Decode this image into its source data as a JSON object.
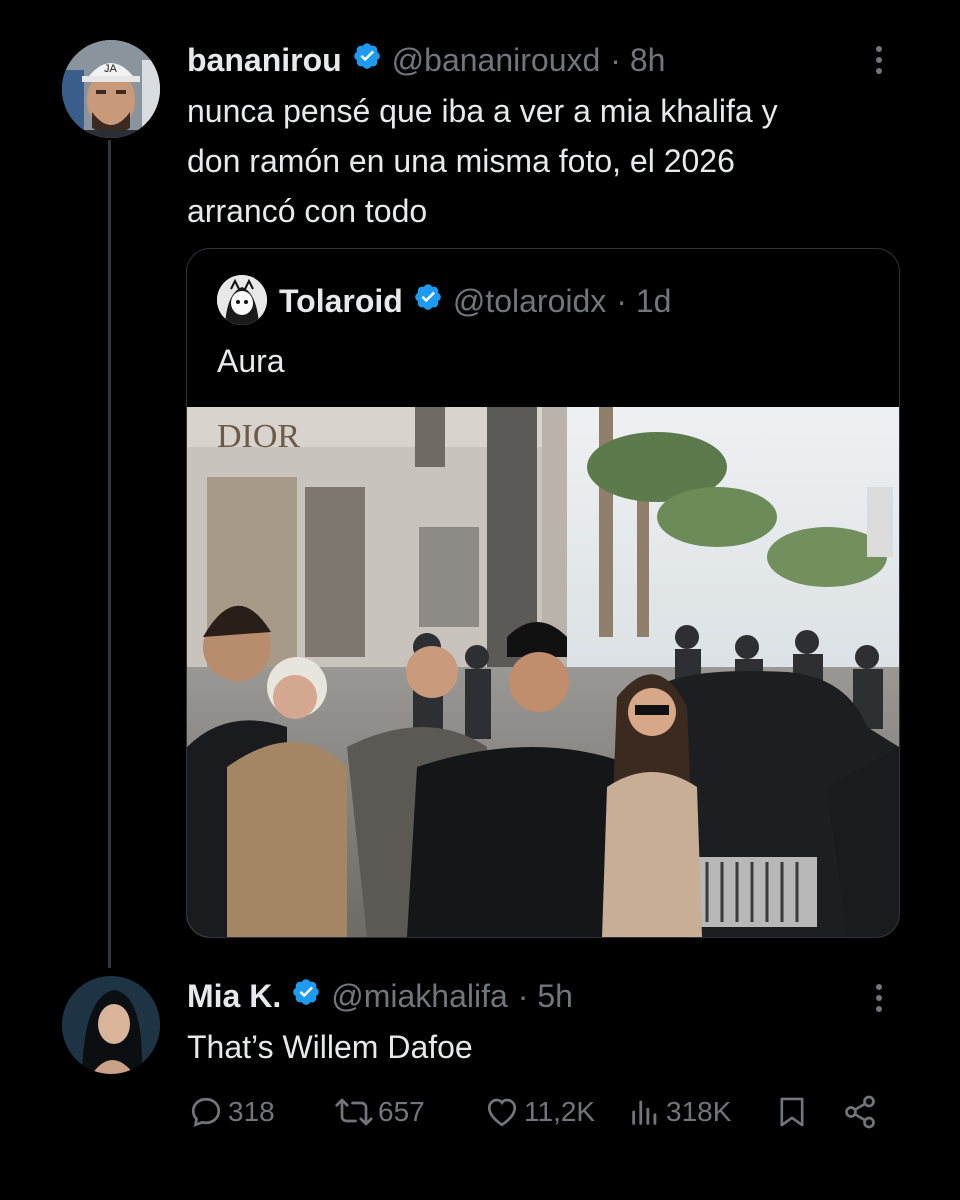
{
  "main_tweet": {
    "display_name": "bananirou",
    "handle": "@bananirouxd",
    "time": "· 8h",
    "text_line1": "nunca pensé que iba a ver a mia khalifa y",
    "text_line2": "don ramón en una misma foto, el 2026",
    "text_line3": "arrancó con todo",
    "avatar_cap_text": "JA"
  },
  "quoted_tweet": {
    "display_name": "Tolaroid",
    "handle": "@tolaroidx",
    "time": "· 1d",
    "text": "Aura",
    "store_sign": "DIOR"
  },
  "reply": {
    "display_name": "Mia K.",
    "handle": "@miakhalifa",
    "time": "· 5h",
    "text": "That’s Willem Dafoe"
  },
  "actions": {
    "replies": "318",
    "reposts": "657",
    "likes": "11,2K",
    "views": "318K"
  },
  "colors": {
    "background": "#000000",
    "text": "#e7e9ea",
    "secondary": "#71767b",
    "verified": "#1d9bf0",
    "border": "#2f3336"
  }
}
